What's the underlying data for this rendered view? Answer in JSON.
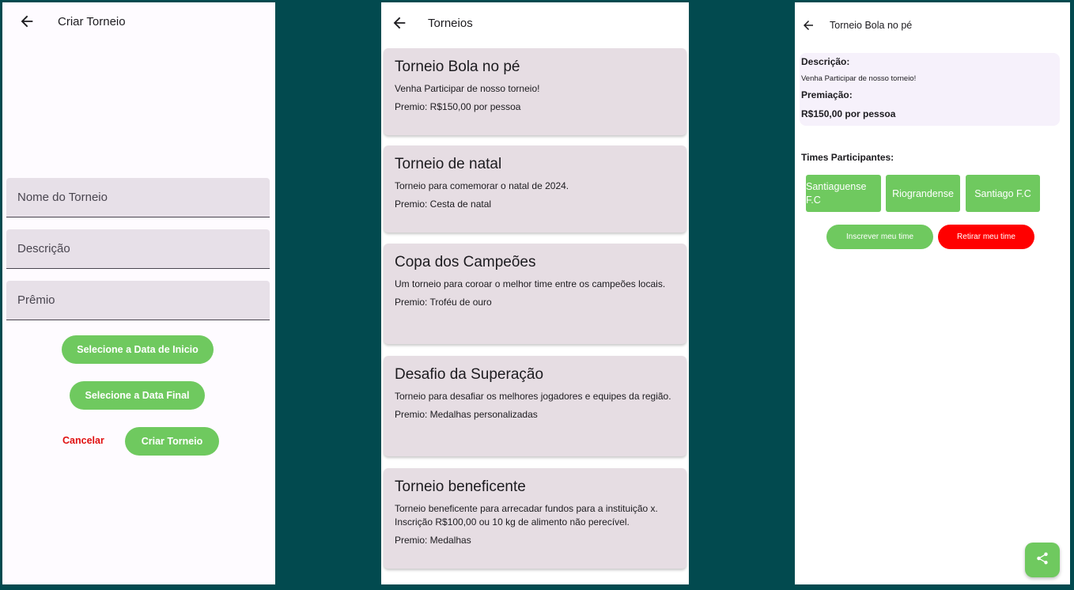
{
  "screen1": {
    "title": "Criar Torneio",
    "fields": {
      "name_placeholder": "Nome do Torneio",
      "description_placeholder": "Descrição",
      "prize_placeholder": "Prêmio"
    },
    "start_date_button": "Selecione a Data de Inicio",
    "end_date_button": "Selecione a Data Final",
    "cancel_button": "Cancelar",
    "create_button": "Criar Torneio"
  },
  "screen2": {
    "title": "Torneios",
    "tournaments": [
      {
        "title": "Torneio Bola no pé",
        "description": "Venha Participar de nosso torneio!",
        "prize": "Premio: R$150,00 por pessoa"
      },
      {
        "title": "Torneio de natal",
        "description": "Torneio para comemorar o natal de 2024.",
        "prize": "Premio: Cesta de natal"
      },
      {
        "title": "Copa dos Campeões",
        "description": "Um torneio para coroar o melhor time entre os campeões locais.",
        "prize": "Premio: Troféu de ouro"
      },
      {
        "title": "Desafio da Superação",
        "description": "Torneio para desafiar os melhores jogadores e equipes da região.",
        "prize": "Premio: Medalhas personalizadas"
      },
      {
        "title": "Torneio beneficente",
        "description": "Torneio beneficente para arrecadar fundos para a instituição x. Inscrição R$100,00 ou 10 kg de alimento não perecível.",
        "prize": "Premio: Medalhas"
      }
    ]
  },
  "screen3": {
    "title": "Torneio Bola no pé",
    "description_label": "Descrição:",
    "description": "Venha Participar de nosso torneio!",
    "prize_label": "Premiação:",
    "prize": "R$150,00 por pessoa",
    "teams_label": "Times Participantes:",
    "teams": [
      "Santiaguense F.C",
      "Riograndense",
      "Santiago F.C"
    ],
    "join_button": "Inscrever meu time",
    "leave_button": "Retirar meu time"
  },
  "colors": {
    "background": "#024a4f",
    "accent_green": "#6fc95f",
    "danger_red": "#ff0000",
    "card": "#e6dde3"
  },
  "icons": [
    "back-arrow-icon",
    "share-icon"
  ]
}
